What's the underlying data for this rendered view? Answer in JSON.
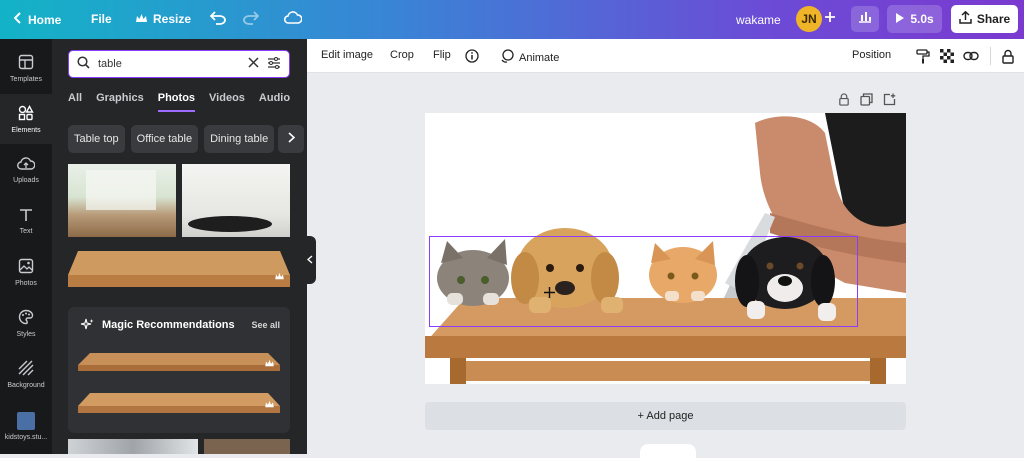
{
  "topbar": {
    "home": "Home",
    "file": "File",
    "resize": "Resize",
    "title": "wakame",
    "avatar": "JN",
    "duration": "5.0s",
    "share": "Share"
  },
  "rail": {
    "items": [
      {
        "label": "Templates",
        "icon": "templates-icon"
      },
      {
        "label": "Elements",
        "icon": "elements-icon"
      },
      {
        "label": "Uploads",
        "icon": "uploads-icon"
      },
      {
        "label": "Text",
        "icon": "text-icon"
      },
      {
        "label": "Photos",
        "icon": "photos-icon"
      },
      {
        "label": "Styles",
        "icon": "styles-icon"
      },
      {
        "label": "Background",
        "icon": "background-icon"
      },
      {
        "label": "kidstoys.stu...",
        "icon": "brand-thumbnail"
      }
    ]
  },
  "panel": {
    "search_value": "table",
    "tabs": [
      "All",
      "Graphics",
      "Photos",
      "Videos",
      "Audio"
    ],
    "active_tab": "Photos",
    "chips": [
      "Table top",
      "Office table",
      "Dining table"
    ],
    "magic_title": "Magic Recommendations",
    "see_all": "See all"
  },
  "toolbar": {
    "edit_image": "Edit image",
    "crop": "Crop",
    "flip": "Flip",
    "animate": "Animate",
    "position": "Position"
  },
  "canvas": {
    "add_page": "+ Add page"
  },
  "colors": {
    "accent": "#8b3dff",
    "panel_bg": "#252627",
    "rail_bg": "#18191b"
  }
}
